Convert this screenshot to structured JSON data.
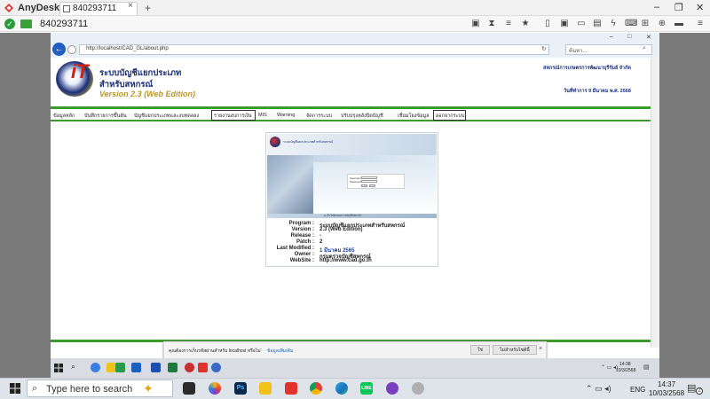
{
  "anydesk": {
    "app_name": "AnyDesk",
    "tab_label": "840293711",
    "address": "840293711",
    "tab_add": "+",
    "tab_close": "×"
  },
  "browser": {
    "url": "http://localhost/CAD_GL/about.php",
    "search_placeholder": "ค้นหา...",
    "search_icon": "search-icon"
  },
  "site": {
    "title_line1": "ระบบบัญชีแยกประเภท",
    "title_line2": "สำหรับสหกรณ์",
    "version": "Version 2.3 (Web Edition)",
    "org": "สหกรณ์การเกษตรการพัฒนาบุรีรัมย์ จำกัด",
    "date": "วันที่ทำการ 9 มีนาคม พ.ศ. 2568"
  },
  "menu": [
    "ข้อมูลหลัก",
    "บันทึกรายการขึ้นต้น",
    "บัญชีแยกประเภทและงบทดลอง",
    "รายงานงบการเงิน",
    "MIS",
    "Warning",
    "จัดการระบบ",
    "ปรับปรุงหลังปิดบัญชี",
    "เชื่อมโยงข้อมูล",
    "ออกจากระบบ"
  ],
  "panel": {
    "header_text": "ระบบบัญชีแยกประเภทสำหรับสหกรณ์",
    "bar_text": "● เว็บไซต์กรมตรวจบัญชีสหกรณ์",
    "login_user": "Username",
    "login_pass": "Password"
  },
  "info": {
    "labels": [
      "Program :",
      "Version :",
      "Release :",
      "Patch :",
      "Last Modified :",
      "Owner :",
      "WebSite :"
    ],
    "values": [
      "ระบบบัญชีแยกประเภทสำหรับสหกรณ์",
      "2.3 (Web Edition)",
      "-",
      "2",
      "1 มีนาคม 2565",
      "กรมตรวจบัญชีสหกรณ์",
      "http://www.cad.go.th"
    ]
  },
  "notification": {
    "text": "คุณต้องการเก็บรหัสผ่านสำหรับ localhost หรือไม่",
    "link": "ข้อมูลเพิ่มเติม",
    "yes": "ใช่",
    "no": "ไม่สำหรับไซต์นี้",
    "close": "×"
  },
  "remote_taskbar": {
    "time": "14:38",
    "date": "10/3/2568"
  },
  "taskbar": {
    "search_placeholder": "Type here to search",
    "lang": "ENG",
    "time": "14:37",
    "date": "10/03/2568",
    "notif_count": "2"
  },
  "colors": {
    "accent_green": "#3a9a2a",
    "title_blue": "#1a2f7a",
    "version_gold": "#b8962a",
    "anydesk_red": "#e2322d"
  }
}
